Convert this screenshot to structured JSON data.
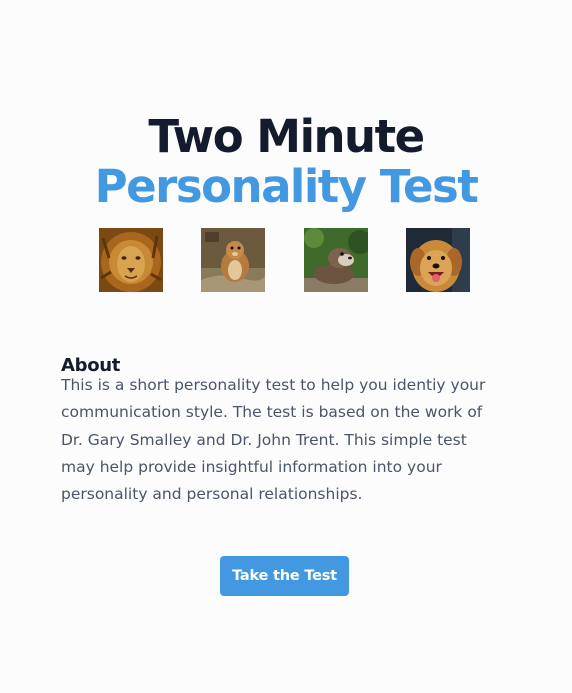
{
  "header": {
    "title_line1": "Two Minute",
    "title_line2": "Personality Test"
  },
  "animals": [
    {
      "name": "lion"
    },
    {
      "name": "marmot"
    },
    {
      "name": "otter"
    },
    {
      "name": "golden-retriever"
    }
  ],
  "about": {
    "heading": "About",
    "lines": [
      "This is a short personality test to help you identiy your",
      "communication style. The test is based on the work of",
      "Dr. Gary Smalley and Dr. John Trent. This simple test",
      "may help provide insightful information into your",
      "personality and personal relationships."
    ]
  },
  "cta": {
    "label": "Take the Test"
  },
  "colors": {
    "accent": "#4299e1",
    "heading": "#141b2d",
    "body_text": "#4a5568",
    "background": "#fcfcfc"
  }
}
